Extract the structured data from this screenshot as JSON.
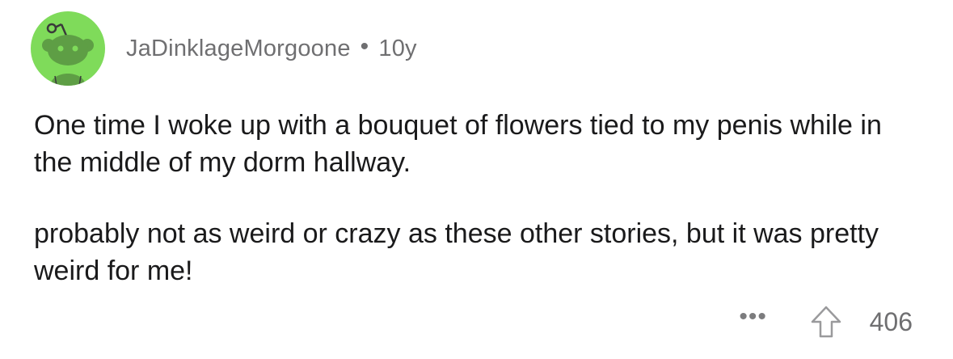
{
  "comment": {
    "author": "JaDinklageMorgoone",
    "separator": "•",
    "age": "10y",
    "avatar_icon": "snoo-avatar-icon",
    "avatar_color": "#7fdb5a",
    "paragraphs": [
      "One time I woke up with a bouquet of flowers tied to my penis while in the middle of my dorm hallway.",
      "probably not as weird or crazy as these other stories, but it was pretty weird for me!"
    ],
    "actions": {
      "more_label": "•••",
      "upvote_icon": "upvote-arrow-icon",
      "score": "406"
    }
  }
}
